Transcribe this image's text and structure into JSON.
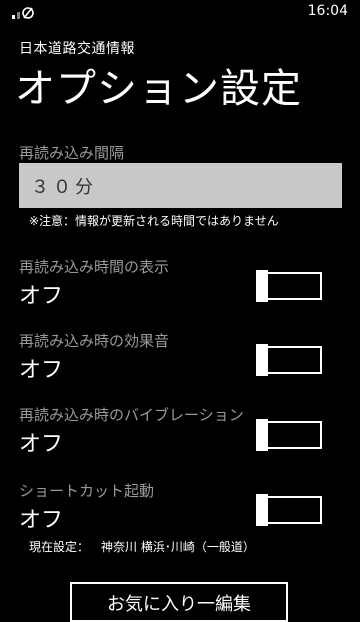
{
  "status_bar": {
    "time": "16:04",
    "icons": [
      "signal-icon"
    ]
  },
  "header": {
    "app_name": "日本道路交通情報",
    "page_title": "オプション設定"
  },
  "refresh_interval": {
    "label": "再読み込み間隔",
    "value": "３０分",
    "note": "※注意：情報が更新される時間ではありません"
  },
  "settings": [
    {
      "label": "再読み込み時間の表示",
      "value": "オフ",
      "on": false
    },
    {
      "label": "再読み込み時の効果音",
      "value": "オフ",
      "on": false
    },
    {
      "label": "再読み込み時のバイブレーション",
      "value": "オフ",
      "on": false
    },
    {
      "label": "ショートカット起動",
      "value": "オフ",
      "on": false
    }
  ],
  "shortcut_current": {
    "label": "現在設定：",
    "value": "神奈川 横浜･川崎（一般道）"
  },
  "bottom_button": {
    "label": "お気に入り一編集"
  }
}
